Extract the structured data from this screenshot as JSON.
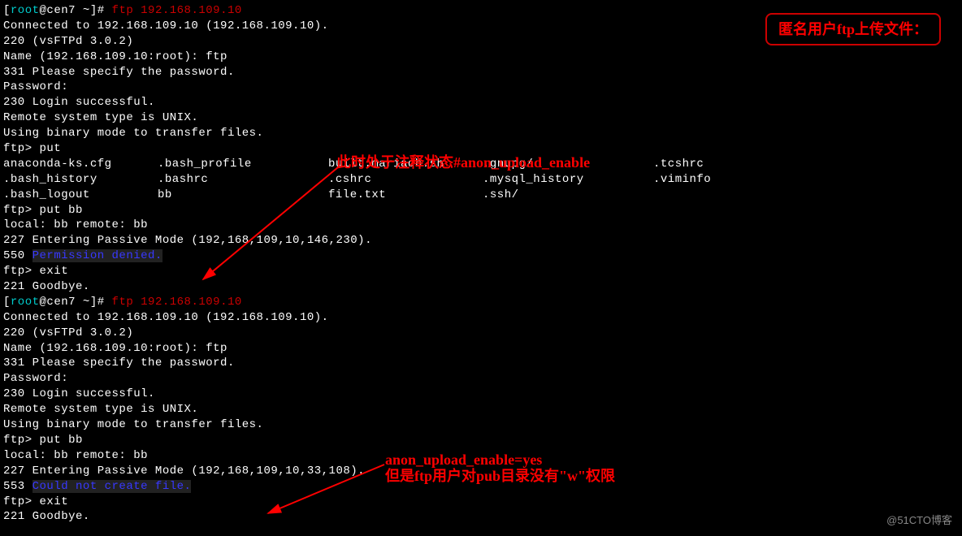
{
  "prompt1": {
    "bracket_open": "[",
    "user": "root",
    "host": "@cen7 ~",
    "bracket_close": "]# ",
    "command": "ftp 192.168.109.10"
  },
  "session1": {
    "connected": "Connected to 192.168.109.10 (192.168.109.10).",
    "version": "220 (vsFTPd 3.0.2)",
    "nameprompt": "Name (192.168.109.10:root): ftp",
    "specify_pass": "331 Please specify the password.",
    "password": "Password:",
    "login_ok": "230 Login successful.",
    "system_type": "Remote system type is UNIX.",
    "binary_mode": "Using binary mode to transfer files.",
    "ftp_put": "ftp> put",
    "ftp_put_bb": "ftp> put bb",
    "local_remote": "local: bb remote: bb",
    "passive": "227 Entering Passive Mode (192,168,109,10,146,230).",
    "err_code": "550 ",
    "err_msg": "Permission denied.",
    "exit": "ftp> exit",
    "goodbye": "221 Goodbye."
  },
  "listing": {
    "r1c1": "anaconda-ks.cfg",
    "r1c2": ".bash_profile",
    "r1c3": "built.mariadb.sh",
    "r1c4": ".gnupg/",
    "r1c5": ".tcshrc",
    "r2c1": ".bash_history",
    "r2c2": ".bashrc",
    "r2c3": ".cshrc",
    "r2c4": ".mysql_history",
    "r2c5": ".viminfo",
    "r3c1": ".bash_logout",
    "r3c2": "bb",
    "r3c3": "file.txt",
    "r3c4": ".ssh/"
  },
  "prompt2": {
    "bracket_open": "[",
    "user": "root",
    "host": "@cen7 ~",
    "bracket_close": "]# ",
    "command": "ftp 192.168.109.10"
  },
  "session2": {
    "connected": "Connected to 192.168.109.10 (192.168.109.10).",
    "version": "220 (vsFTPd 3.0.2)",
    "nameprompt": "Name (192.168.109.10:root): ftp",
    "specify_pass": "331 Please specify the password.",
    "password": "Password:",
    "login_ok": "230 Login successful.",
    "system_type": "Remote system type is UNIX.",
    "binary_mode": "Using binary mode to transfer files.",
    "ftp_put_bb": "ftp> put bb",
    "local_remote": "local: bb remote: bb",
    "passive": "227 Entering Passive Mode (192,168,109,10,33,108).",
    "err_code": "553 ",
    "err_msg": "Could not create file.",
    "exit": "ftp> exit",
    "goodbye": "221 Goodbye."
  },
  "annotations": {
    "box": "匿名用户ftp上传文件：",
    "ann1": "此时处于注释状态#anon_upload_enable",
    "ann2": "anon_upload_enable=yes",
    "ann3": "但是ftp用户对pub目录没有\"w\"权限"
  },
  "watermark": "@51CTO博客"
}
